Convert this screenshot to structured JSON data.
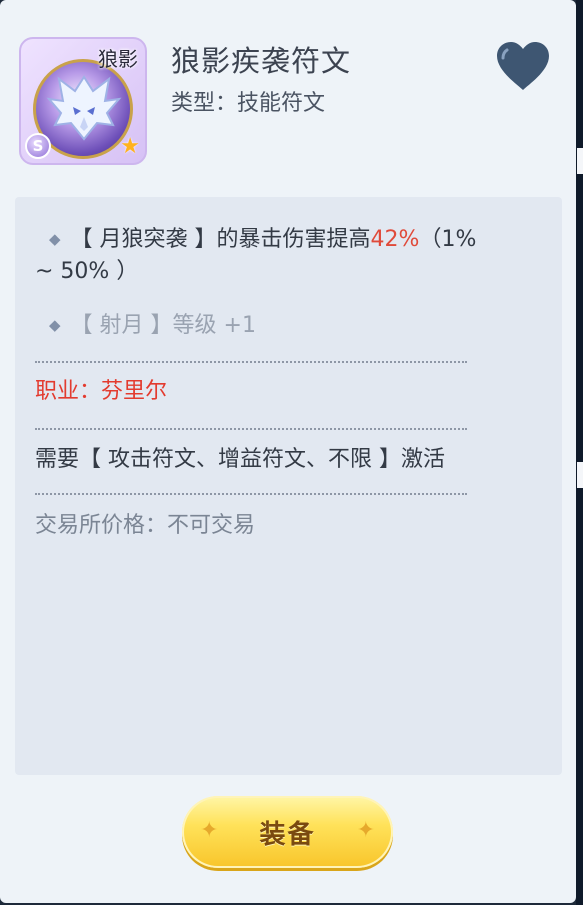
{
  "item": {
    "icon_label": "狼影",
    "rank_badge": "S",
    "name": "狼影疾袭符文",
    "type_line": "类型：技能符文"
  },
  "icons": {
    "favorite": "heart-icon",
    "star": "star-icon",
    "bullet": "diamond-bullet-icon",
    "spark": "sparkle-icon"
  },
  "colors": {
    "highlight": "#e04a3a",
    "job": "#e33b2f",
    "heart": "#3e5672",
    "button": "#ffd84a"
  },
  "effects": [
    {
      "prefix": "【 月狼突袭 】的暴击伤害提高",
      "value": "42%",
      "range_a": "（1%",
      "range_b": "~ 50% ）"
    },
    {
      "text": "【 射月 】等级 +1"
    }
  ],
  "job": "职业：芬里尔",
  "requirement": "需要【 攻击符文、增益符文、不限 】激活",
  "trade_price": "交易所价格：不可交易",
  "button": {
    "equip_label": "装备"
  }
}
